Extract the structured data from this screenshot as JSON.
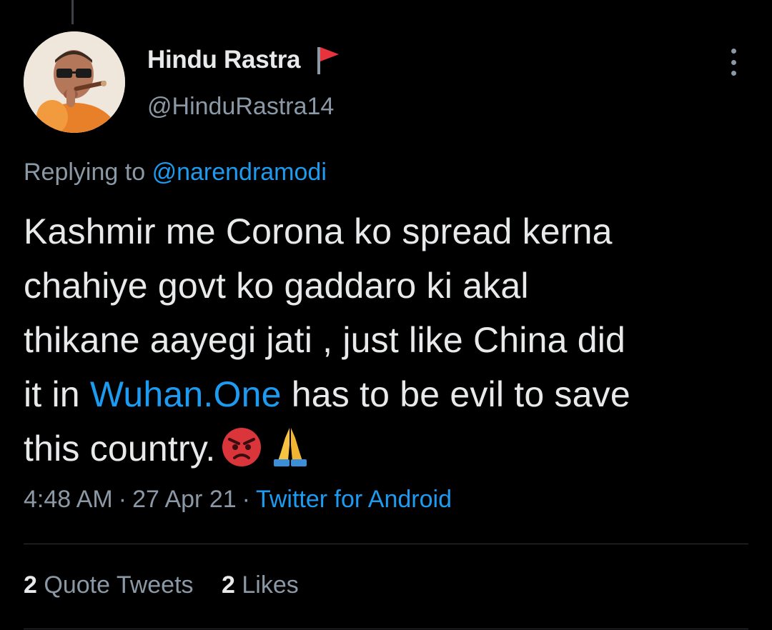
{
  "tweet": {
    "author": {
      "display_name": "Hindu Rastra",
      "handle": "@HinduRastra14",
      "avatar_icon": "profile-photo",
      "badge_icon": "red-flag-icon"
    },
    "replying_prefix": "Replying to",
    "replying_to": "@narendramodi",
    "text_lines": [
      "Kashmir me Corona ko spread kerna",
      "chahiye govt ko gaddaro ki akal",
      "thikane aayegi jati , just like China did"
    ],
    "line4_prefix": "it in ",
    "line4_link": "Wuhan.One",
    "line4_suffix": " has to be evil to save",
    "line5_text": "this country.",
    "emojis": [
      "angry-face-emoji",
      "folded-hands-emoji"
    ],
    "time": "4:48 AM",
    "date": "27 Apr 21",
    "source": "Twitter for Android",
    "separator": "·"
  },
  "stats": {
    "quote_tweets_count": "2",
    "quote_tweets_label": "Quote Tweets",
    "likes_count": "2",
    "likes_label": "Likes"
  },
  "colors": {
    "background": "#000000",
    "text": "#e7e9ea",
    "secondary": "#8b98a5",
    "link": "#1d9bf0",
    "divider": "#2f3336",
    "flag": "#e8323c"
  }
}
